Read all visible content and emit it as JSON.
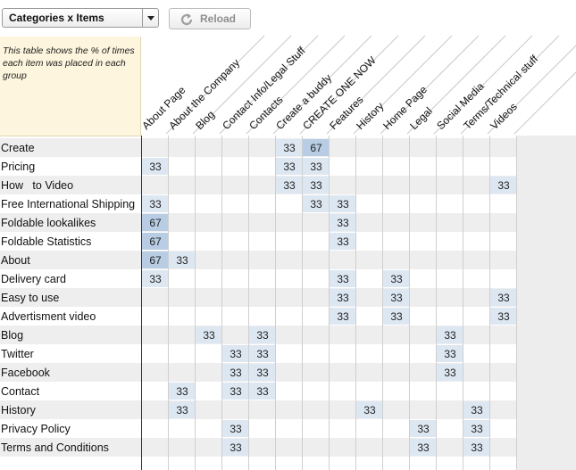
{
  "toolbar": {
    "view_select": "Categories x Items",
    "reload_label": "Reload",
    "reload_icon": "reload-icon"
  },
  "info_text": "This table shows the % of times each item was placed in each group",
  "columns": [
    "About Page",
    "About the Company",
    "Blog",
    "Contact Info/Legal Stuff",
    "Contacts",
    "Create a buddy",
    "CREATE ONE NOW",
    "Features",
    "History",
    "Home Page",
    "Legal",
    "Social Media",
    "Terms/Technical stuff",
    "Videos"
  ],
  "rows": [
    {
      "label": "Create",
      "cells": [
        null,
        null,
        null,
        null,
        null,
        "33",
        "67",
        null,
        null,
        null,
        null,
        null,
        null,
        null
      ]
    },
    {
      "label": "Pricing",
      "cells": [
        "33",
        null,
        null,
        null,
        null,
        "33",
        "33",
        null,
        null,
        null,
        null,
        null,
        null,
        null
      ]
    },
    {
      "label": "How   to Video",
      "cells": [
        null,
        null,
        null,
        null,
        null,
        "33",
        "33",
        null,
        null,
        null,
        null,
        null,
        null,
        "33"
      ]
    },
    {
      "label": "Free International Shipping",
      "cells": [
        "33",
        null,
        null,
        null,
        null,
        null,
        "33",
        "33",
        null,
        null,
        null,
        null,
        null,
        null
      ]
    },
    {
      "label": "Foldable lookalikes",
      "cells": [
        "67",
        null,
        null,
        null,
        null,
        null,
        null,
        "33",
        null,
        null,
        null,
        null,
        null,
        null
      ]
    },
    {
      "label": "Foldable Statistics",
      "cells": [
        "67",
        null,
        null,
        null,
        null,
        null,
        null,
        "33",
        null,
        null,
        null,
        null,
        null,
        null
      ]
    },
    {
      "label": "About",
      "cells": [
        "67",
        "33",
        null,
        null,
        null,
        null,
        null,
        null,
        null,
        null,
        null,
        null,
        null,
        null
      ]
    },
    {
      "label": "Delivery card",
      "cells": [
        "33",
        null,
        null,
        null,
        null,
        null,
        null,
        "33",
        null,
        "33",
        null,
        null,
        null,
        null
      ]
    },
    {
      "label": "Easy to use",
      "cells": [
        null,
        null,
        null,
        null,
        null,
        null,
        null,
        "33",
        null,
        "33",
        null,
        null,
        null,
        "33"
      ]
    },
    {
      "label": "Advertisment video",
      "cells": [
        null,
        null,
        null,
        null,
        null,
        null,
        null,
        "33",
        null,
        "33",
        null,
        null,
        null,
        "33"
      ]
    },
    {
      "label": "Blog",
      "cells": [
        null,
        null,
        "33",
        null,
        "33",
        null,
        null,
        null,
        null,
        null,
        null,
        "33",
        null,
        null
      ]
    },
    {
      "label": "Twitter",
      "cells": [
        null,
        null,
        null,
        "33",
        "33",
        null,
        null,
        null,
        null,
        null,
        null,
        "33",
        null,
        null
      ]
    },
    {
      "label": "Facebook",
      "cells": [
        null,
        null,
        null,
        "33",
        "33",
        null,
        null,
        null,
        null,
        null,
        null,
        "33",
        null,
        null
      ]
    },
    {
      "label": "Contact",
      "cells": [
        null,
        "33",
        null,
        "33",
        "33",
        null,
        null,
        null,
        null,
        null,
        null,
        null,
        null,
        null
      ]
    },
    {
      "label": "History",
      "cells": [
        null,
        "33",
        null,
        null,
        null,
        null,
        null,
        null,
        "33",
        null,
        null,
        null,
        "33",
        null
      ]
    },
    {
      "label": "Privacy Policy",
      "cells": [
        null,
        null,
        null,
        "33",
        null,
        null,
        null,
        null,
        null,
        null,
        "33",
        null,
        "33",
        null
      ]
    },
    {
      "label": "Terms and Conditions",
      "cells": [
        null,
        null,
        null,
        "33",
        null,
        null,
        null,
        null,
        null,
        null,
        "33",
        null,
        "33",
        null
      ]
    }
  ],
  "colors": {
    "cell_33": "#dde7f2",
    "cell_67": "#b8cde4",
    "stripe": "#eeeeee",
    "header_line": "#c9c9c9",
    "info_bg": "#fdf5dd"
  }
}
